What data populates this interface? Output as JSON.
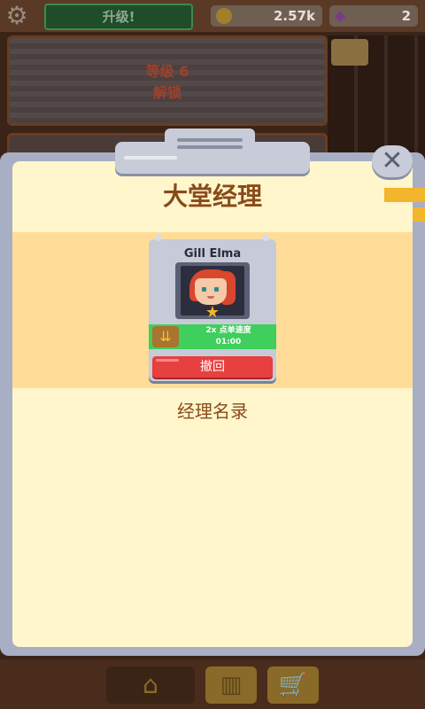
{
  "topbar": {
    "gear_icon": "gear-icon",
    "upgrade_label": "升级!",
    "coins": "2.57k",
    "gems": "2"
  },
  "shaft": {
    "level_label": "等级 6",
    "unlock_label": "解锁"
  },
  "modal": {
    "title": "大堂经理",
    "close_glyph": "✕",
    "manager": {
      "name": "Gill Elma",
      "skill_text": "2x 点单速度",
      "skill_time": "01:00",
      "recall_label": "撤回"
    },
    "roster_label": "经理名录"
  },
  "nav": {
    "home_icon": "home-icon",
    "library_icon": "library-icon",
    "shop_icon": "cart-icon"
  },
  "colors": {
    "accent_green": "#3ecf5c",
    "recall_red": "#e83f3f",
    "title_brown": "#8a4a1a",
    "panel_cream": "#fff6cc"
  }
}
